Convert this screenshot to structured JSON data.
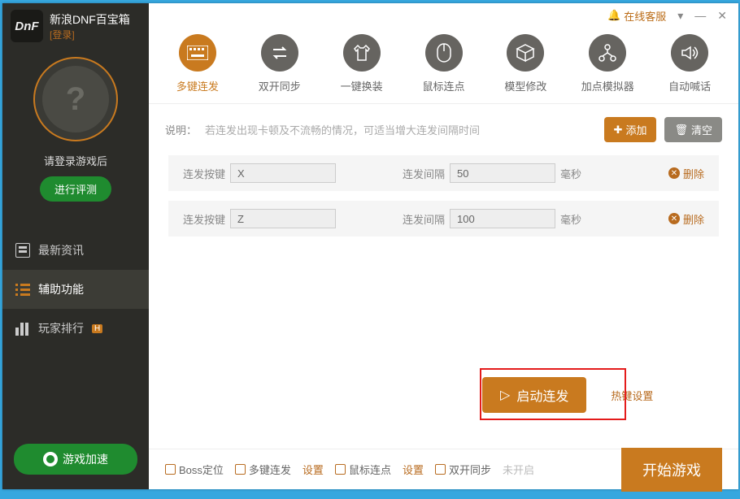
{
  "app": {
    "title": "新浪DNF百宝箱",
    "login": "[登录]"
  },
  "titlebar": {
    "support": "在线客服"
  },
  "sidebar": {
    "login_prompt": "请登录游戏后",
    "eval_btn": "进行评测",
    "nav": {
      "news": "最新资讯",
      "assist": "辅助功能",
      "rank": "玩家排行",
      "hot": "H"
    },
    "boost": "游戏加速"
  },
  "tools": [
    {
      "key": "multikey",
      "label": "多键连发"
    },
    {
      "key": "dualsync",
      "label": "双开同步"
    },
    {
      "key": "outfit",
      "label": "一键换装"
    },
    {
      "key": "autoclick",
      "label": "鼠标连点"
    },
    {
      "key": "model",
      "label": "模型修改"
    },
    {
      "key": "simulator",
      "label": "加点模拟器"
    },
    {
      "key": "autoshout",
      "label": "自动喊话"
    }
  ],
  "desc": {
    "label": "说明：",
    "text": "若连发出现卡顿及不流畅的情况，可适当增大连发间隔时间"
  },
  "buttons": {
    "add": "添加",
    "clear": "清空",
    "start": "启动连发",
    "hotkey": "热键设置",
    "start_game": "开始游戏",
    "delete": "删除"
  },
  "row_labels": {
    "key": "连发按键",
    "interval": "连发间隔",
    "unit": "毫秒"
  },
  "rows": [
    {
      "key": "X",
      "interval": "50"
    },
    {
      "key": "Z",
      "interval": "100"
    }
  ],
  "footer": {
    "boss": "Boss定位",
    "multi": "多键连发",
    "click": "鼠标连点",
    "dual": "双开同步",
    "settings": "设置",
    "not_enabled": "未开启"
  }
}
